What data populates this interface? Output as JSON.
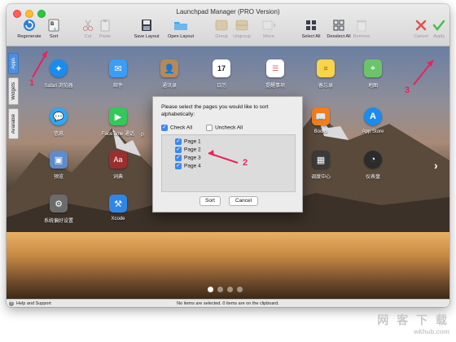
{
  "window": {
    "title": "Launchpad Manager (PRO Version)"
  },
  "toolbar": {
    "regenerate": "Regenerate",
    "sort": "Sort",
    "cut": "Cut",
    "paste": "Paste",
    "save_layout": "Save Layout",
    "open_layout": "Open Layout",
    "group": "Group",
    "ungroup": "Ungroup",
    "move": "Move",
    "select_all": "Select All",
    "deselect_all": "Deselect All",
    "remove": "Remove",
    "cancel": "Cancel",
    "apply": "Apply"
  },
  "side_tabs": {
    "apps": "Apps",
    "widgets": "Widgets",
    "available": "Available"
  },
  "apps": [
    {
      "name": "Safari 浏览器",
      "icon": "safari-icon",
      "color": "#1a8cf0"
    },
    {
      "name": "邮件",
      "icon": "mail-icon",
      "color": "#3c9df4"
    },
    {
      "name": "通讯录",
      "icon": "contacts-icon",
      "color": "#b58a5a"
    },
    {
      "name": "日历",
      "icon": "calendar-icon",
      "color": "#ffffff"
    },
    {
      "name": "提醒事项",
      "icon": "reminders-icon",
      "color": "#ffffff"
    },
    {
      "name": "备忘录",
      "icon": "notes-icon",
      "color": "#f7d44a"
    },
    {
      "name": "地图",
      "icon": "maps-icon",
      "color": "#6cc36a"
    },
    {
      "name": "信息",
      "icon": "messages-icon",
      "color": "#2ea7f5"
    },
    {
      "name": "FaceTime 通话",
      "icon": "facetime-icon",
      "color": "#34c759"
    },
    {
      "name": "Books",
      "icon": "books-icon",
      "color": "#f07f1e"
    },
    {
      "name": "App Store",
      "icon": "app-store-icon",
      "color": "#1a8cf0"
    },
    {
      "name": "预览",
      "icon": "preview-icon",
      "color": "#5e8bc9"
    },
    {
      "name": "词典",
      "icon": "dictionary-icon",
      "color": "#9a2f2f"
    },
    {
      "name": "调度中心",
      "icon": "mission-control-icon",
      "color": "#3a3a3a"
    },
    {
      "name": "仪表盘",
      "icon": "dashboard-icon",
      "color": "#2b2b2b"
    },
    {
      "name": "系统偏好设置",
      "icon": "system-preferences-icon",
      "color": "#6b6b6b"
    },
    {
      "name": "Xcode",
      "icon": "xcode-icon",
      "color": "#2f86e6"
    }
  ],
  "partial_label": "P",
  "dialog": {
    "prompt": "Please select the pages you would like to sort alphabetically:",
    "check_all": "Check All",
    "uncheck_all": "Uncheck All",
    "pages": [
      "Page 1",
      "Page 2",
      "Page 3",
      "Page 4"
    ],
    "sort_button": "Sort",
    "cancel_button": "Cancel"
  },
  "annotations": [
    "1",
    "2",
    "3"
  ],
  "status": {
    "help": "Help and Support",
    "message": "No items are selected. 0 items are on the clipboard."
  },
  "watermark": {
    "line1": "网 客 下 载",
    "line2": "wkhub.com"
  },
  "colors": {
    "accent": "#3b88f0",
    "annotation": "#e8245a"
  }
}
